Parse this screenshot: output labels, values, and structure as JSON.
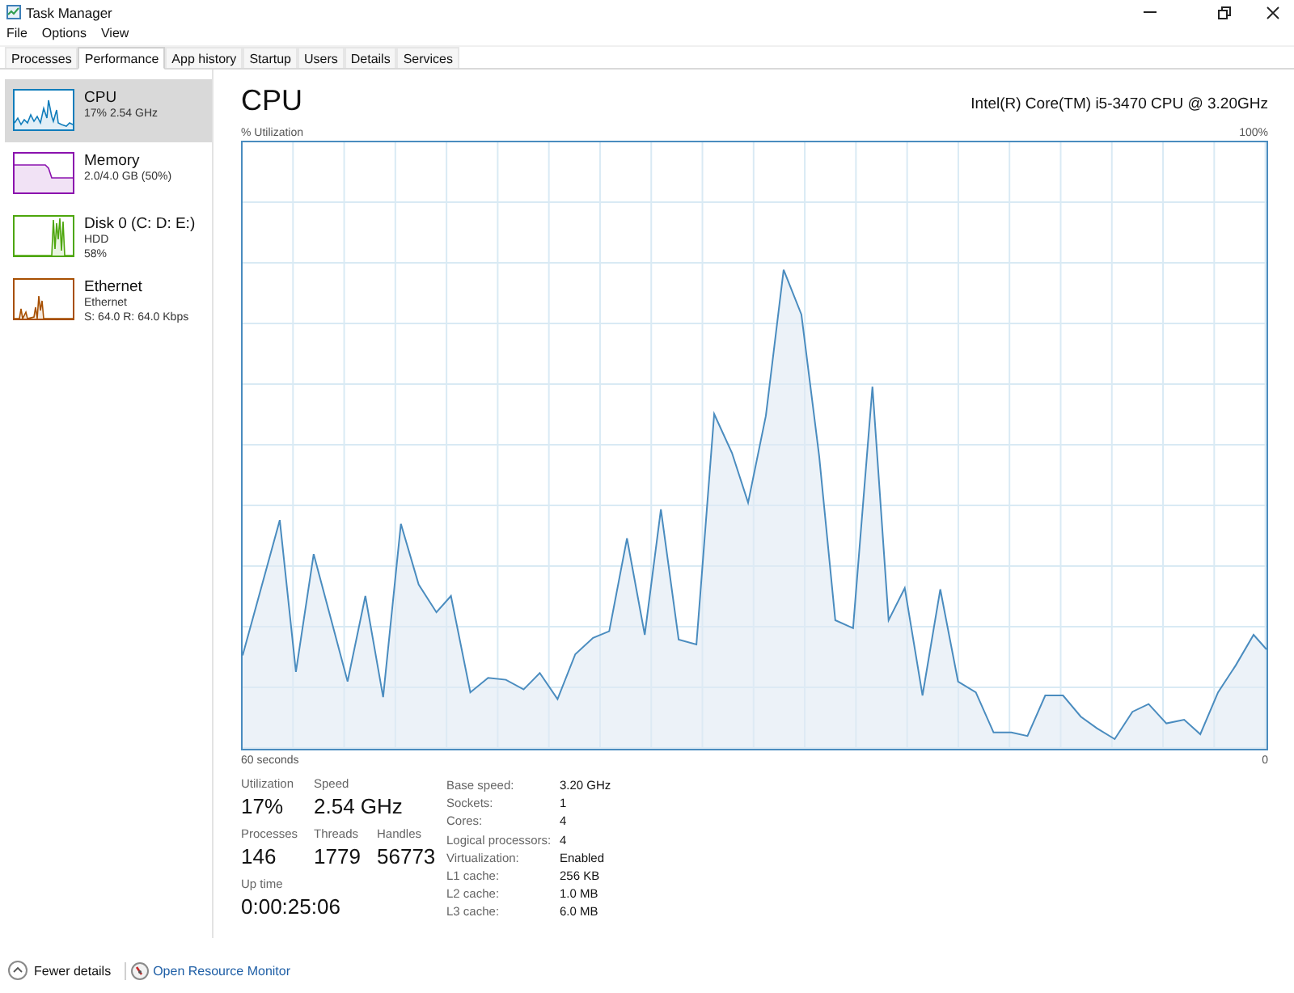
{
  "window": {
    "title": "Task Manager"
  },
  "menu": [
    "File",
    "Options",
    "View"
  ],
  "tabs": [
    {
      "label": "Processes",
      "selected": false
    },
    {
      "label": "Performance",
      "selected": true
    },
    {
      "label": "App history",
      "selected": false
    },
    {
      "label": "Startup",
      "selected": false
    },
    {
      "label": "Users",
      "selected": false
    },
    {
      "label": "Details",
      "selected": false
    },
    {
      "label": "Services",
      "selected": false
    }
  ],
  "sidebar": {
    "items": [
      {
        "kind": "cpu",
        "title": "CPU",
        "details": [
          "17% 2.54 GHz"
        ],
        "color": "#117dbb",
        "selected": true
      },
      {
        "kind": "memory",
        "title": "Memory",
        "details": [
          "2.0/4.0 GB (50%)"
        ],
        "color": "#8b12ae",
        "selected": false
      },
      {
        "kind": "disk",
        "title": "Disk 0 (C: D: E:)",
        "details": [
          "HDD",
          "58%"
        ],
        "color": "#4da60c",
        "selected": false
      },
      {
        "kind": "ethernet",
        "title": "Ethernet",
        "details": [
          "Ethernet",
          "S: 64.0 R: 64.0 Kbps"
        ],
        "color": "#a74f01",
        "selected": false
      }
    ]
  },
  "panel": {
    "title": "CPU",
    "device": "Intel(R) Core(TM) i5-3470 CPU @ 3.20GHz",
    "graph": {
      "utilization_label": "% Utilization",
      "max_label": "100%",
      "time_span_label": "60 seconds",
      "time_end_label": "0"
    },
    "stats": [
      [
        {
          "label": "Utilization",
          "value": "17%"
        },
        {
          "label": "Speed",
          "value": "2.54 GHz"
        }
      ],
      [
        {
          "label": "Processes",
          "value": "146"
        },
        {
          "label": "Threads",
          "value": "1779"
        },
        {
          "label": "Handles",
          "value": "56773"
        }
      ],
      [
        {
          "label": "Up time",
          "value": "0:00:25:06"
        }
      ]
    ],
    "details": [
      {
        "label": "Base speed:",
        "value": "3.20 GHz"
      },
      {
        "label": "Sockets:",
        "value": "1"
      },
      {
        "label": "Cores:",
        "value": "4"
      },
      {
        "label": "Logical processors:",
        "value": "4"
      },
      {
        "label": "Virtualization:",
        "value": "Enabled"
      },
      {
        "label": "L1 cache:",
        "value": "256 KB"
      },
      {
        "label": "L2 cache:",
        "value": "1.0 MB"
      },
      {
        "label": "L3 cache:",
        "value": "6.0 MB"
      }
    ]
  },
  "footer": {
    "toggle": "Fewer details",
    "link": "Open Resource Monitor"
  }
}
